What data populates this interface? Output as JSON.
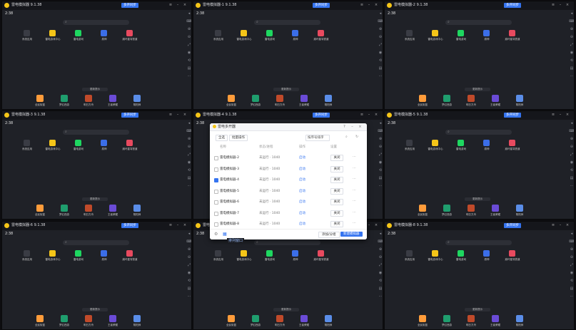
{
  "window": {
    "title": "雷电模拟器 9 9.1.38",
    "titles": [
      "雷电模拟器 9.1.38",
      "雷电模拟器-1 9.1.38",
      "雷电模拟器-2 9.1.38",
      "雷电模拟器-3 9.1.38",
      "雷电模拟器-4 9.1.38",
      "雷电模拟器-5 9.1.38",
      "雷电模拟器-6 9.1.38",
      "雷电模拟器-7 9.1.38",
      "雷电模拟器-8 9.1.38"
    ],
    "tag": "多开同步",
    "time": "2:38"
  },
  "desktop": {
    "icons": [
      "系统应用",
      "雷电游戏中心",
      "雷电游戏",
      "原神",
      "崩坏星穹铁道"
    ],
    "dock": [
      "全民街篮",
      "梦幻西游",
      "明日方舟",
      "王者荣耀",
      "阴阳师"
    ],
    "dockbar_text": "更新提示"
  },
  "dialog": {
    "title": "雷电多开器",
    "toolbar": {
      "all": "全选",
      "batch": "批量操作",
      "sort": "按序号排序",
      "search_icon": "search-icon"
    },
    "columns": [
      "名称",
      "状态/进程",
      "操作",
      "设置"
    ],
    "rows": [
      {
        "name": "雷电模拟器-2",
        "status": "未运行 · 1040",
        "op": "启动",
        "action": "关闭",
        "checked": false
      },
      {
        "name": "雷电模拟器-3",
        "status": "未运行 · 1040",
        "op": "启动",
        "action": "关闭",
        "checked": false
      },
      {
        "name": "雷电模拟器-4",
        "status": "未运行 · 1040",
        "op": "启动",
        "action": "关闭",
        "checked": true
      },
      {
        "name": "雷电模拟器-5",
        "status": "未运行 · 1040",
        "op": "启动",
        "action": "关闭",
        "checked": false
      },
      {
        "name": "雷电模拟器-6",
        "status": "未运行 · 1040",
        "op": "启动",
        "action": "关闭",
        "checked": false
      },
      {
        "name": "雷电模拟器-7",
        "status": "未运行 · 1040",
        "op": "启动",
        "action": "关闭",
        "checked": false
      },
      {
        "name": "雷电模拟器-8",
        "status": "未运行 · 1040",
        "op": "启动",
        "action": "关闭",
        "checked": false
      }
    ],
    "footer": {
      "add": "添加/分组",
      "new": "新建模拟器",
      "tooltip": "排列窗口"
    }
  },
  "colors": {
    "accent": "#3574f0",
    "bg": "#1f2127",
    "titlebar": "#15161b",
    "logo": "#f5c518"
  }
}
